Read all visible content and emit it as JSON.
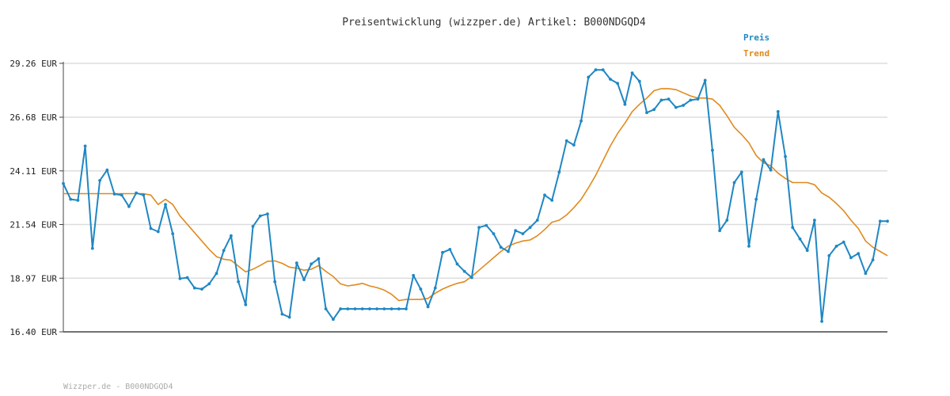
{
  "chart_data": {
    "type": "line",
    "title": "Preisentwicklung (wizzper.de) Artikel: B000NDGQD4",
    "footer": "Wizzper.de - B000NDGQD4",
    "ylim": [
      16.4,
      29.26
    ],
    "yticks": [
      "29.26 EUR",
      "26.68 EUR",
      "24.11 EUR",
      "21.54 EUR",
      "18.97 EUR",
      "16.40 EUR"
    ],
    "ytick_values": [
      29.26,
      26.68,
      24.11,
      21.54,
      18.97,
      16.4
    ],
    "grid": true,
    "legend_position": "top-right",
    "colors": {
      "price": "#1f87c3",
      "trend": "#e08a1e",
      "grid": "#dddddd",
      "axis": "#444444"
    },
    "series": [
      {
        "name": "Preis",
        "color": "#1f87c3",
        "markers": true,
        "values": [
          23.5,
          22.75,
          22.7,
          25.3,
          20.4,
          23.65,
          24.15,
          23.0,
          22.95,
          22.4,
          23.05,
          22.95,
          21.35,
          21.2,
          22.5,
          21.1,
          18.95,
          19.0,
          18.5,
          18.45,
          18.7,
          19.2,
          20.3,
          21.0,
          18.8,
          17.7,
          21.45,
          21.95,
          22.05,
          18.8,
          17.25,
          17.1,
          19.7,
          18.9,
          19.65,
          19.9,
          17.5,
          17.0,
          17.5,
          17.5,
          17.5,
          17.5,
          17.5,
          17.5,
          17.5,
          17.5,
          17.5,
          17.5,
          19.1,
          18.45,
          17.6,
          18.5,
          20.2,
          20.35,
          19.65,
          19.3,
          19.0,
          21.4,
          21.5,
          21.1,
          20.45,
          20.25,
          21.25,
          21.1,
          21.4,
          21.75,
          22.95,
          22.7,
          24.05,
          25.55,
          25.35,
          26.5,
          28.6,
          28.95,
          28.95,
          28.5,
          28.3,
          27.3,
          28.8,
          28.4,
          26.9,
          27.05,
          27.5,
          27.55,
          27.15,
          27.25,
          27.5,
          27.55,
          28.45,
          25.1,
          21.25,
          21.75,
          23.55,
          24.05,
          20.5,
          22.75,
          24.65,
          24.15,
          26.95,
          24.8,
          21.4,
          20.85,
          20.3,
          21.75,
          16.9,
          20.05,
          20.5,
          20.7,
          19.95,
          20.15,
          19.2,
          19.85,
          21.7,
          21.7
        ]
      },
      {
        "name": "Trend",
        "color": "#e08a1e",
        "markers": false,
        "values": [
          23.02,
          23.02,
          23.02,
          23.02,
          23.02,
          23.02,
          23.02,
          23.02,
          23.02,
          23.02,
          23.02,
          23.02,
          22.95,
          22.5,
          22.75,
          22.5,
          21.95,
          21.55,
          21.15,
          20.75,
          20.35,
          20.0,
          19.88,
          19.83,
          19.55,
          19.27,
          19.4,
          19.58,
          19.78,
          19.8,
          19.68,
          19.5,
          19.45,
          19.35,
          19.4,
          19.57,
          19.3,
          19.05,
          18.7,
          18.6,
          18.65,
          18.72,
          18.6,
          18.52,
          18.4,
          18.2,
          17.9,
          17.95,
          17.95,
          17.95,
          18.0,
          18.25,
          18.45,
          18.6,
          18.72,
          18.8,
          19.05,
          19.35,
          19.65,
          19.95,
          20.25,
          20.5,
          20.65,
          20.75,
          20.8,
          21.0,
          21.3,
          21.65,
          21.75,
          22.0,
          22.35,
          22.75,
          23.3,
          23.9,
          24.6,
          25.3,
          25.9,
          26.4,
          26.95,
          27.3,
          27.6,
          27.95,
          28.05,
          28.05,
          28.0,
          27.85,
          27.7,
          27.6,
          27.6,
          27.55,
          27.25,
          26.75,
          26.2,
          25.85,
          25.45,
          24.85,
          24.5,
          24.35,
          24.0,
          23.75,
          23.55,
          23.55,
          23.55,
          23.45,
          23.05,
          22.85,
          22.55,
          22.2,
          21.75,
          21.35,
          20.75,
          20.45,
          20.25,
          20.05
        ]
      }
    ]
  }
}
